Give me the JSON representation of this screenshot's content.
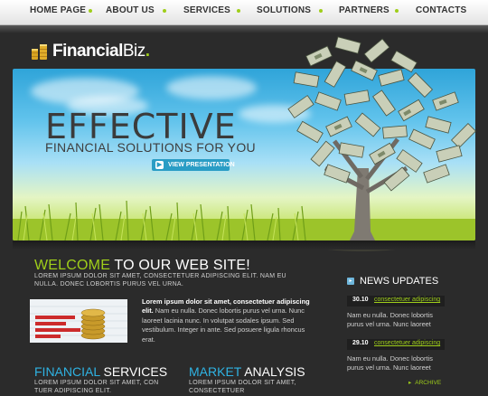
{
  "nav": {
    "items": [
      "HOME PAGE",
      "ABOUT US",
      "SERVICES",
      "SOLUTIONS",
      "PARTNERS",
      "CONTACTS"
    ]
  },
  "logo": {
    "part1": "Financial",
    "part2": "Biz",
    "dot": "."
  },
  "banner": {
    "title": "EFFECTIVE",
    "subtitle": "FINANCIAL SOLUTIONS FOR YOU",
    "button": "VIEW PRESENTATION"
  },
  "welcome": {
    "title_highlight": "WELCOME",
    "title_rest": " TO OUR WEB SITE!",
    "caps_text": "LOREM IPSUM DOLOR SIT AMET, CONSECTETUER ADIPISCING ELIT. NAM EU NULLA. DONEC LOBORTIS PURUS VEL URNA.",
    "body_bold": "Lorem ipsum dolor sit amet, consectetuer adipiscing elit.",
    "body_rest": " Nam eu nulla. Donec lobortis purus vel urna. Nunc laoreet lacinia nunc. In volutpat sodales ipsum. Sed vestibulum. Integer in ante. Sed posuere ligula rhoncus erat."
  },
  "news": {
    "title": "NEWS UPDATES",
    "items": [
      {
        "date": "30.10",
        "link": "consectetuer adipiscing",
        "text": "Nam eu nulla. Donec lobortis purus vel urna. Nunc laoreet"
      },
      {
        "date": "29.10",
        "link": "consectetuer adipiscing",
        "text": "Nam eu nulla. Donec lobortis purus vel urna. Nunc laoreet"
      }
    ],
    "archive": "ARCHIVE"
  },
  "columns": [
    {
      "title_highlight": "FINANCIAL",
      "title_rest": " SERVICES",
      "caps_text": "LOREM IPSUM DOLOR SIT AMET, CON TUER ADIPISCING ELIT."
    },
    {
      "title_highlight": "MARKET",
      "title_rest": " ANALYSIS",
      "caps_text": "LOREM IPSUM DOLOR SIT AMET, CONSECTETUER"
    }
  ],
  "colors": {
    "accent_green": "#9fce1a",
    "accent_blue": "#2fb3e3",
    "background": "#2b2b2b"
  }
}
